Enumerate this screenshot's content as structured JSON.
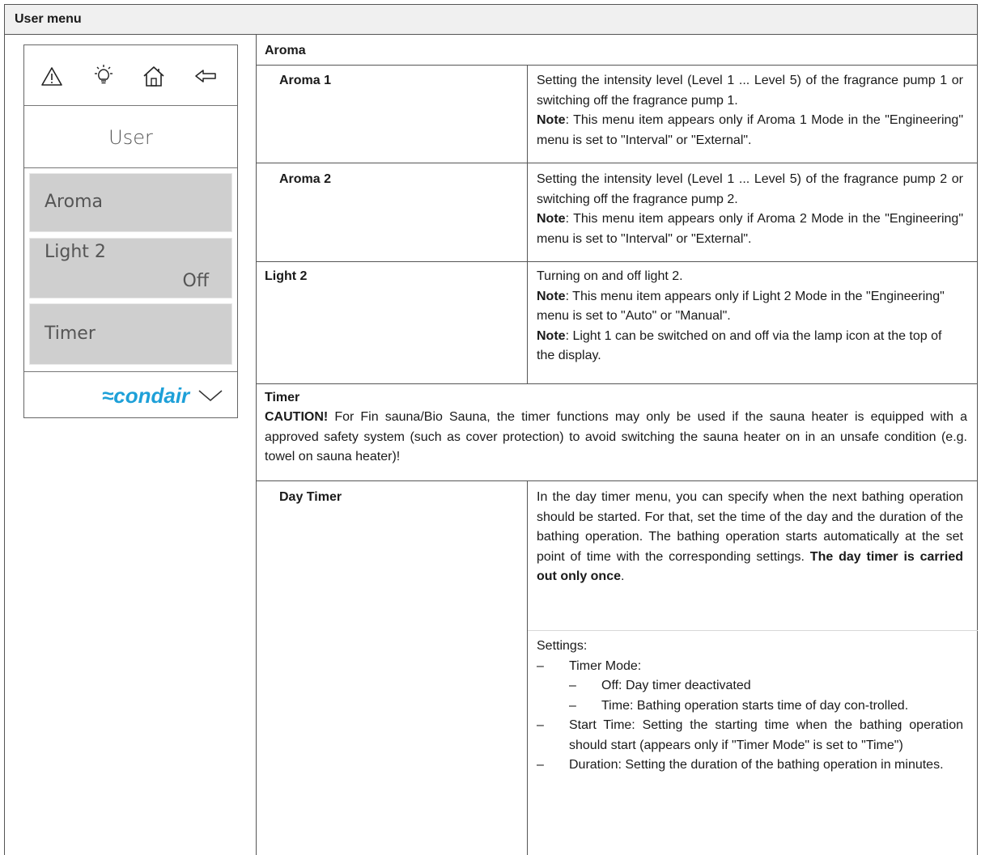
{
  "title": "User menu",
  "device": {
    "icons": [
      "warning-icon",
      "lightbulb-icon",
      "home-icon",
      "back-arrow-icon"
    ],
    "header": "User",
    "buttons": [
      {
        "label": "Aroma",
        "value": ""
      },
      {
        "label": "Light 2",
        "value": "Off"
      },
      {
        "label": "Timer",
        "value": ""
      }
    ],
    "logo": "≈condair",
    "chevron": "chevron-down-icon"
  },
  "sections": {
    "aroma": {
      "heading": "Aroma",
      "items": [
        {
          "name": "Aroma 1",
          "desc": "Setting the intensity level (Level 1 ... Level 5) of the fragrance pump 1 or switching off the fragrance pump 1.",
          "note_label": "Note",
          "note": ": This menu item appears only if Aroma 1 Mode in the \"Engineering\" menu is set to \"Interval\" or \"External\"."
        },
        {
          "name": "Aroma 2",
          "desc": "Setting the intensity level (Level 1 ... Level 5) of the fragrance pump 2 or switching off the fragrance pump 2.",
          "note_label": "Note",
          "note": ": This menu item appears only if Aroma 2 Mode in the \"Engineering\" menu is set to \"Interval\" or \"External\"."
        }
      ]
    },
    "light2": {
      "name": "Light 2",
      "desc": "Turning on and off light 2.",
      "note1_label": "Note",
      "note1": ": This menu item appears only if Light 2 Mode in the \"Engineering\" menu is set to \"Auto\" or \"Manual\".",
      "note2_label": "Note",
      "note2": ": Light 1 can be switched on and off via the lamp icon at the top of the display."
    },
    "timer": {
      "heading": "Timer",
      "caution_label": "CAUTION!",
      "caution": " For Fin sauna/Bio Sauna, the timer functions may only be used if the sauna heater is equipped with a approved safety system (such as cover protection) to avoid switching the sauna heater on in an unsafe condition (e.g. towel on sauna heater)!",
      "day_timer": {
        "name": "Day Timer",
        "desc": "In the day timer menu, you can specify when the next bathing operation should be started. For that, set the time of the day and the duration of the bathing operation. The bathing operation starts automatically at the set point of time with the corresponding settings. ",
        "desc_bold": "The day timer is carried out only once",
        "desc_end": ".",
        "settings_label": "Settings:",
        "timer_mode": "Timer Mode:",
        "mode_off": "Off: Day timer deactivated",
        "mode_time": "Time: Bathing operation starts time of day con-trolled.",
        "start_time": "Start Time: Setting the starting time when the bathing operation should start (appears only if \"Timer Mode\" is set to \"Time\")",
        "duration": "Duration: Setting the duration of the bathing operation in minutes."
      }
    }
  }
}
